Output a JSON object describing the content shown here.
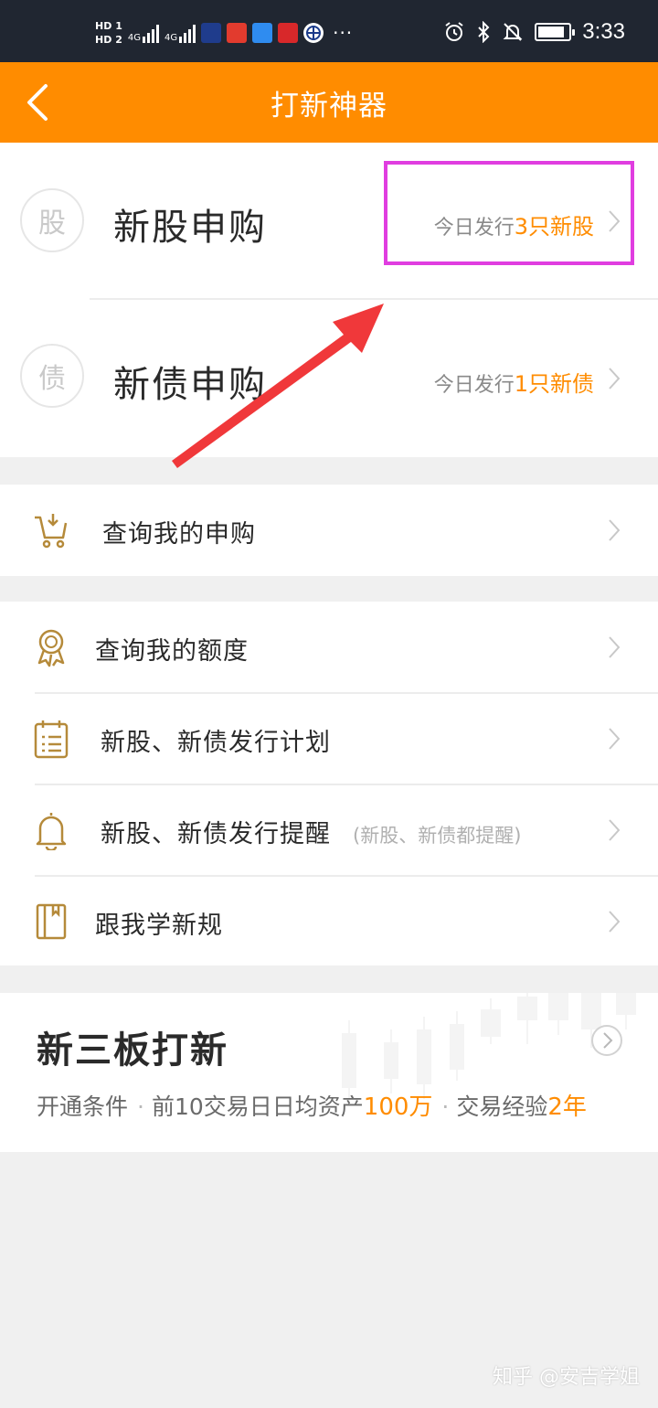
{
  "status_bar": {
    "hd1": "HD",
    "hd2": "HD",
    "hd1_sub": "1",
    "hd2_sub": "2",
    "net1": "4G",
    "net2": "4G",
    "time": "3:33"
  },
  "nav": {
    "title": "打新神器",
    "color": "#ff8c00"
  },
  "subscriptions": [
    {
      "badge": "股",
      "title": "新股申购",
      "info_prefix": "今日发行",
      "info_highlight": "3只新股"
    },
    {
      "badge": "债",
      "title": "新债申购",
      "info_prefix": "今日发行",
      "info_highlight": "1只新债"
    }
  ],
  "menu_query": {
    "label": "查询我的申购"
  },
  "menu": [
    {
      "label": "查询我的额度"
    },
    {
      "label": "新股、新债发行计划"
    },
    {
      "label": "新股、新债发行提醒",
      "hint": "(新股、新债都提醒)"
    },
    {
      "label": "跟我学新规"
    }
  ],
  "neeq": {
    "title": "新三板打新",
    "condition_label": "开通条件",
    "cond1_prefix": "前10交易日日均资产",
    "cond1_value": "100万",
    "cond2_prefix": "交易经验",
    "cond2_value": "2年"
  },
  "watermark": "知乎 @安吉学姐",
  "colors": {
    "accent": "#ff8c00",
    "annotation_box": "#e03de0",
    "annotation_arrow": "#f0383a"
  }
}
